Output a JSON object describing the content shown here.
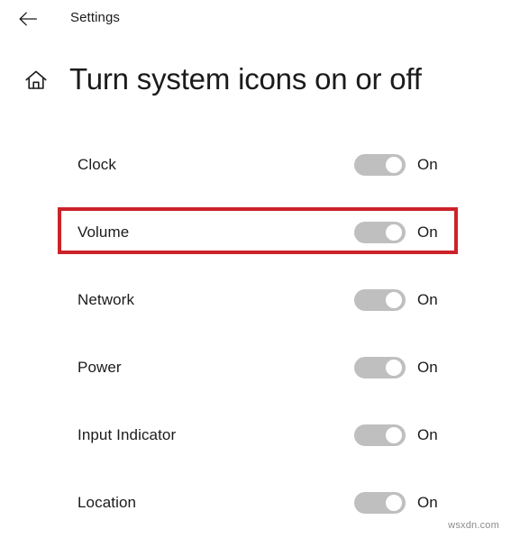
{
  "window": {
    "app_title": "Settings",
    "back_icon": "back-arrow-icon"
  },
  "header": {
    "home_icon": "home-icon",
    "page_title": "Turn system icons on or off"
  },
  "settings": {
    "rows": [
      {
        "label": "Clock",
        "state": "On",
        "checked": true
      },
      {
        "label": "Volume",
        "state": "On",
        "checked": true
      },
      {
        "label": "Network",
        "state": "On",
        "checked": true
      },
      {
        "label": "Power",
        "state": "On",
        "checked": true
      },
      {
        "label": "Input Indicator",
        "state": "On",
        "checked": true
      },
      {
        "label": "Location",
        "state": "On",
        "checked": true
      }
    ]
  },
  "annotation": {
    "target_row_label": "Volume",
    "color": "#cc2229"
  },
  "watermark": {
    "text": "wsxdn.com"
  },
  "colors": {
    "background": "#ffffff",
    "text": "#1b1b1b",
    "toggle_track": "#bfbfbf",
    "toggle_knob": "#ffffff",
    "annotation_red": "#cc2229",
    "watermark_text": "#8c8c8c"
  }
}
